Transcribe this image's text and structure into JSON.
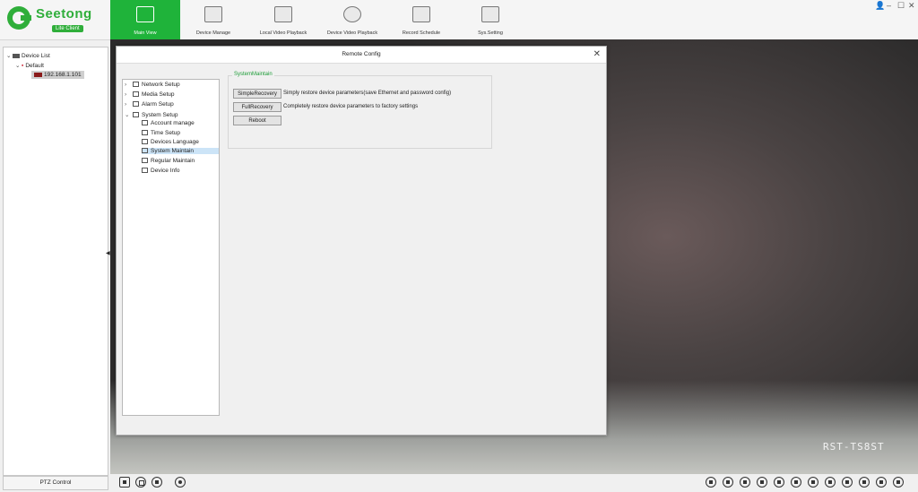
{
  "app": {
    "brand": "Seetong",
    "subtitle": "Lite Client"
  },
  "nav": [
    {
      "label": "Main View",
      "icon": "monitor-play-icon",
      "active": true
    },
    {
      "label": "Device Manage",
      "icon": "device-manage-icon",
      "active": false
    },
    {
      "label": "Local Video Playback",
      "icon": "film-icon",
      "active": false
    },
    {
      "label": "Device Video Playback",
      "icon": "replay-icon",
      "active": false
    },
    {
      "label": "Record Schedule",
      "icon": "schedule-icon",
      "active": false
    },
    {
      "label": "Sys.Setting",
      "icon": "settings-monitor-icon",
      "active": false
    }
  ],
  "window_controls": [
    "user-icon",
    "minimize-icon",
    "maximize-icon",
    "close-icon"
  ],
  "device_tree": {
    "root": "Device List",
    "group": "Default",
    "device": "192.168.1.101"
  },
  "ptz_label": "PTZ Control",
  "video": {
    "osd": "RST-TS8ST"
  },
  "dialog": {
    "title": "Remote Config",
    "tree": [
      {
        "label": "Network Setup",
        "level": 0,
        "expander": "›"
      },
      {
        "label": "Media Setup",
        "level": 0,
        "expander": "›"
      },
      {
        "label": "Alarm Setup",
        "level": 0,
        "expander": "›"
      },
      {
        "label": "System Setup",
        "level": 0,
        "expander": "⌄"
      },
      {
        "label": "Account manage",
        "level": 1,
        "expander": ""
      },
      {
        "label": "Time Setup",
        "level": 1,
        "expander": ""
      },
      {
        "label": "Devices Language",
        "level": 1,
        "expander": ""
      },
      {
        "label": "System Maintain",
        "level": 1,
        "expander": "",
        "selected": true
      },
      {
        "label": "Regular Maintain",
        "level": 1,
        "expander": ""
      },
      {
        "label": "Device Info",
        "level": 1,
        "expander": ""
      }
    ],
    "group_title": "SystemMaintain",
    "simple_recovery": {
      "label": "SimpleRecovery",
      "desc": "Simply restore device parameters(save Ethernet and password config)"
    },
    "full_recovery": {
      "label": "FullRecovery",
      "desc": "Completely restore device parameters to factory settings"
    },
    "reboot": {
      "label": "Reboot"
    }
  },
  "colors": {
    "accent": "#1fb33a",
    "group_title": "#1c9c37",
    "selection": "#cce4f7"
  }
}
